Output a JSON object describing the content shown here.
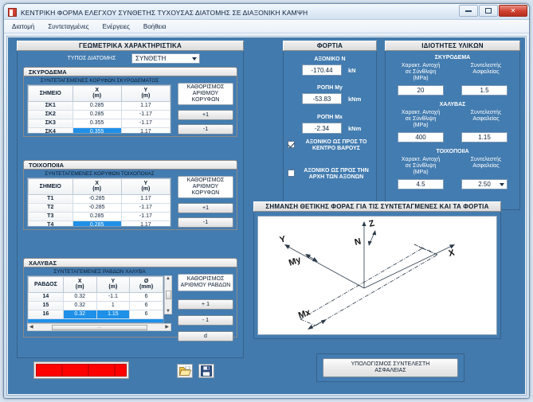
{
  "window": {
    "title": "ΚΕΝΤΡΙΚΗ ΦΟΡΜΑ ΕΛΕΓΧΟΥ ΣΥΝΘΕΤΗΣ ΤΥΧΟΥΣΑΣ ΔΙΑΤΟΜΗΣ ΣΕ ΔΙΑΞΟΝΙΚΗ ΚΑΜΨΗ",
    "app_icon": "app-icon",
    "minimize": "minimize-button",
    "maximize": "maximize-button",
    "close_label": "✕"
  },
  "menu": {
    "items": [
      {
        "label": "Διατομή"
      },
      {
        "label": "Συντεταγμένες"
      },
      {
        "label": "Ενέργειες"
      },
      {
        "label": "Βοήθεια"
      }
    ]
  },
  "geometry": {
    "header": "ΓΕΩΜΕΤΡΙΚΑ ΧΑΡΑΚΤΗΡΙΣΤΙΚΑ",
    "section_type_label": "ΤΥΠΟΣ ΔΙΑΤΟΜΗΣ",
    "section_type_value": "ΣΥΝΘΕΤΗ",
    "concrete": {
      "tab_label": "ΣΚΥΡΟΔΕΜΑ",
      "table_caption": "ΣΥΝΤΕΤΑΓΕΜΕΝΕΣ ΚΟΡΥΦΩΝ ΣΚΥΡΟΔΕΜΑΤΟΣ",
      "columns": [
        "ΣΗΜΕΙΟ",
        "X\n(m)",
        "Y\n(m)"
      ],
      "col_point": "ΣΗΜΕΙΟ",
      "col_x": "X",
      "col_x_unit": "(m)",
      "col_y": "Y",
      "col_y_unit": "(m)",
      "rows": [
        {
          "point": "ΣΚ1",
          "x": "0.285",
          "y": "1.17"
        },
        {
          "point": "ΣΚ2",
          "x": "0.285",
          "y": "-1.17"
        },
        {
          "point": "ΣΚ3",
          "x": "0.355",
          "y": "-1.17"
        },
        {
          "point": "ΣΚ4",
          "x": "0.355",
          "y": "1.17"
        }
      ],
      "selected_row": 3,
      "define_button": "ΚΑΘΟΡΙΣΜΟΣ\nΑΡΙΘΜΟΥ\nΚΟΡΥΦΩΝ",
      "define_button_l1": "ΚΑΘΟΡΙΣΜΟΣ",
      "define_button_l2": "ΑΡΙΘΜΟΥ",
      "define_button_l3": "ΚΟΡΥΦΩΝ",
      "plus_button": "+1",
      "minus_button": "-1"
    },
    "masonry": {
      "tab_label": "ΤΟΙΧΟΠΟΙΙΑ",
      "table_caption": "ΣΥΝΤΕΤΑΓΕΜΕΝΕΣ ΚΟΡΥΦΩΝ ΤΟΙΧΟΠΟΙΙΑΣ",
      "col_point": "ΣΗΜΕΙΟ",
      "col_x": "X",
      "col_x_unit": "(m)",
      "col_y": "Y",
      "col_y_unit": "(m)",
      "rows": [
        {
          "point": "Τ1",
          "x": "-0.285",
          "y": "1.17"
        },
        {
          "point": "Τ2",
          "x": "-0.285",
          "y": "-1.17"
        },
        {
          "point": "Τ3",
          "x": "0.285",
          "y": "-1.17"
        },
        {
          "point": "Τ4",
          "x": "0.285",
          "y": "1.17"
        }
      ],
      "selected_row": 3,
      "define_button_l1": "ΚΑΘΟΡΙΣΜΟΣ",
      "define_button_l2": "ΑΡΙΘΜΟΥ",
      "define_button_l3": "ΚΟΡΥΦΩΝ",
      "plus_button": "+1",
      "minus_button": "-1"
    },
    "steel": {
      "tab_label": "ΧΑΛΥΒΑΣ",
      "table_caption": "ΣΥΝΤΕΤΑΓΕΜΕΝΕΣ ΡΑΒΔΩΝ ΧΑΛΥΒΑ",
      "col_bar": "ΡΑΒΔΟΣ",
      "col_x": "X",
      "col_x_unit": "(m)",
      "col_y": "Y",
      "col_y_unit": "(m)",
      "col_d": "Ø",
      "col_d_unit": "(mm)",
      "rows": [
        {
          "bar": "14",
          "x": "0.32",
          "y": "-1.1",
          "d": "6"
        },
        {
          "bar": "15",
          "x": "0.32",
          "y": "1",
          "d": "6"
        },
        {
          "bar": "16",
          "x": "0.32",
          "y": "1.15",
          "d": "6"
        }
      ],
      "selected_row": 2,
      "define_button_l1": "ΚΑΘΟΡΙΣΜΟΣ",
      "define_button_l2": "ΑΡΙΘΜΟΥ ΡΑΒΔΩΝ",
      "plus_button": "+ 1",
      "minus_button": "- 1",
      "d_button": "d"
    }
  },
  "loads": {
    "header": "ΦΟΡΤΙΑ",
    "axial_label": "ΑΞΟΝΙΚΟ Ν",
    "axial_value": "-170.44",
    "axial_unit": "kN",
    "my_label": "ΡΟΠΗ My",
    "my_value": "-53.83",
    "my_unit": "kNm",
    "mx_label": "ΡΟΠΗ Mx",
    "mx_value": "-2.34",
    "mx_unit": "kNm",
    "checkbox_centroid_l1": "ΑΞΟΝΙΚΟ ΩΣ ΠΡΟΣ ΤΟ",
    "checkbox_centroid_l2": "ΚΕΝΤΡΟ ΒΑΡΟΥΣ",
    "checkbox_centroid_checked": true,
    "checkbox_origin_l1": "ΑΞΟΝΙΚΟ ΩΣ ΠΡΟΣ ΤΗΝ",
    "checkbox_origin_l2": "ΑΡΧΗ ΤΩΝ ΑΞΟΝΩΝ",
    "checkbox_origin_checked": false
  },
  "materials": {
    "header": "ΙΔΙΟΤΗΤΕΣ ΥΛΙΚΩΝ",
    "concrete": {
      "title": "ΣΚΥΡΟΔΕΜΑ",
      "strength_l1": "Χαρακτ. Αντοχή",
      "strength_l2": "σε Σύνθλιψη",
      "strength_l3": "(MPa)",
      "safety_l1": "Συντελεστής",
      "safety_l2": "Ασφαλείας",
      "strength_value": "20",
      "safety_value": "1.5"
    },
    "steel": {
      "title": "ΧΑΛΥΒΑΣ",
      "strength_l1": "Χαρακτ. Αντοχή",
      "strength_l2": "σε Σύνθλιψη",
      "strength_l3": "(MPa)",
      "safety_l1": "Συντελεστής",
      "safety_l2": "Ασφαλείας",
      "strength_value": "400",
      "safety_value": "1.15"
    },
    "masonry": {
      "title": "ΤΟΙΧΟΠΟΙΙΑ",
      "strength_l1": "Χαρακτ. Αντοχή",
      "strength_l2": "σε Σύνθλιψη",
      "strength_l3": "(MPa)",
      "safety_l1": "Συντελεστής",
      "safety_l2": "Ασφαλείας",
      "strength_value": "4.5",
      "safety_value": "2.50"
    }
  },
  "diagram": {
    "header": "ΣΗΜΑΝΣΗ ΘΕΤΙΚΗΣ ΦΟΡΑΣ ΓΙΑ ΤΙΣ ΣΥΝΤΕΤΑΓΜΕΝΕΣ ΚΑΙ ΤΑ ΦΟΡΤΙΑ",
    "labels": {
      "z": "Z",
      "y": "Y",
      "x": "X",
      "n": "N",
      "my": "My",
      "mx": "Mx"
    }
  },
  "footer": {
    "progress_percent": 100,
    "open_icon": "folder-open-icon",
    "save_icon": "save-icon",
    "calc_button_l1": "ΥΠΟΛΟΓΙΣΜΟΣ ΣΥΝΤΕΛΕΣΤΗ",
    "calc_button_l2": "ΑΣΦΑΛΕΙΑΣ"
  },
  "colors": {
    "panel_blue": "#427aad",
    "accent_select": "#1e90e8",
    "progress_red": "#ff0000"
  }
}
